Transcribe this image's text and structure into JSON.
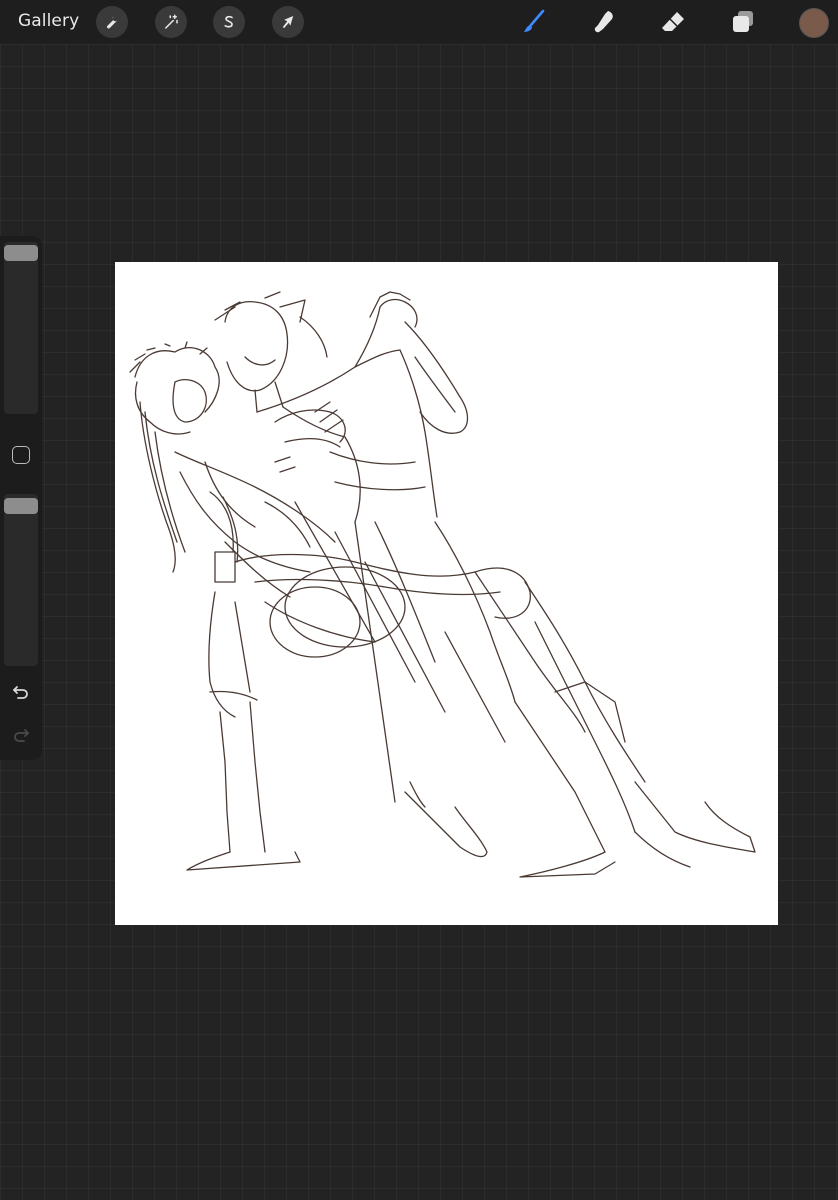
{
  "topbar": {
    "gallery_label": "Gallery",
    "left_tools": [
      {
        "name": "actions",
        "icon": "wrench-icon"
      },
      {
        "name": "adjustments",
        "icon": "magic-wand-icon"
      },
      {
        "name": "selection",
        "icon": "selection-s-icon"
      },
      {
        "name": "transform",
        "icon": "arrow-cursor-icon"
      }
    ],
    "right_tools": [
      {
        "name": "brush",
        "icon": "brush-icon",
        "active": true
      },
      {
        "name": "smudge",
        "icon": "smudge-icon",
        "active": false
      },
      {
        "name": "eraser",
        "icon": "eraser-icon",
        "active": false
      },
      {
        "name": "layers",
        "icon": "layers-icon",
        "active": false
      }
    ],
    "current_color": "#7a5a4a",
    "active_color": "#3d8bff"
  },
  "sidebar": {
    "brush_size_level": 1.0,
    "opacity_level": 1.0,
    "modify_icon": "square-icon",
    "undo_icon": "undo-icon",
    "redo_icon": "redo-icon"
  },
  "canvas": {
    "artwork": "sketch",
    "stroke_color": "#4a3a34"
  }
}
